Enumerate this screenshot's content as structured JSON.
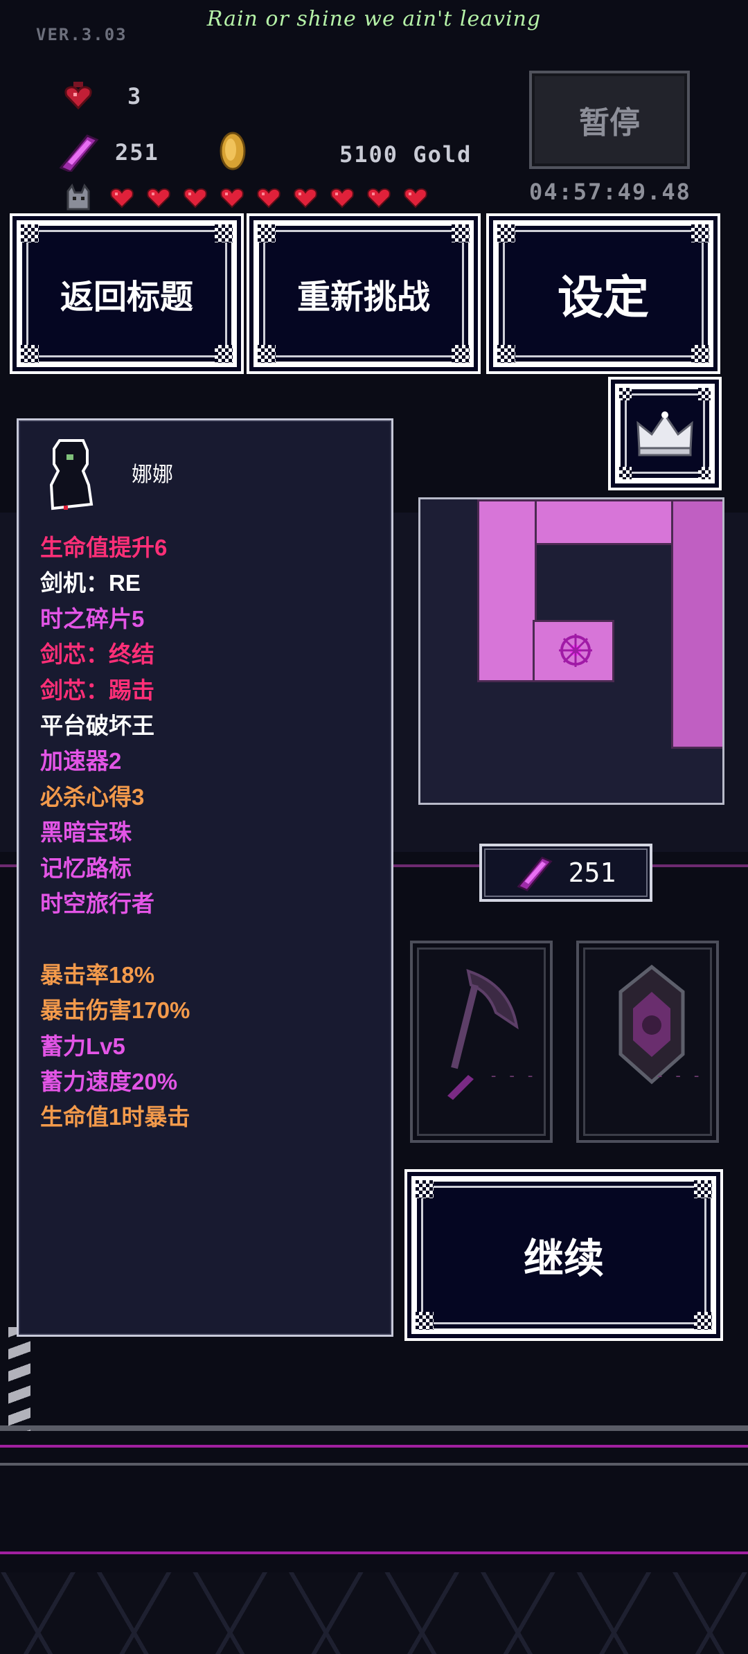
{
  "header": {
    "version": "VER.3.03",
    "now_playing": "Rain or shine we ain't leaving"
  },
  "stats": {
    "potions": "3",
    "crystals": "251",
    "gold": "5100 Gold",
    "health_hearts": 9
  },
  "top_right": {
    "pause_label": "暂停",
    "timer": "04:57:49.48"
  },
  "menu": {
    "return_title": "返回标题",
    "retry": "重新挑战",
    "settings": "设定"
  },
  "character": {
    "name": "娜娜"
  },
  "items": [
    {
      "text": "生命值提升6",
      "color": "#ff2f77"
    },
    {
      "text": "剑机：RE",
      "color": "#ffffff"
    },
    {
      "text": "时之碎片5",
      "color": "#e355e6"
    },
    {
      "text": "剑芯：终结",
      "color": "#ff2f77"
    },
    {
      "text": "剑芯：踢击",
      "color": "#ff2f77"
    },
    {
      "text": "平台破坏王",
      "color": "#ffffff"
    },
    {
      "text": "加速器2",
      "color": "#e355e6"
    },
    {
      "text": "必杀心得3",
      "color": "#f39a4b"
    },
    {
      "text": "黑暗宝珠",
      "color": "#e355e6"
    },
    {
      "text": "记忆路标",
      "color": "#e355e6"
    },
    {
      "text": "时空旅行者",
      "color": "#e355e6"
    }
  ],
  "bonuses": [
    {
      "text": "暴击率18%",
      "color": "#f39a4b"
    },
    {
      "text": "暴击伤害170%",
      "color": "#f39a4b"
    },
    {
      "text": "蓄力Lv5",
      "color": "#e355e6"
    },
    {
      "text": "蓄力速度20%",
      "color": "#e355e6"
    },
    {
      "text": "生命值1时暴击",
      "color": "#f39a4b"
    }
  ],
  "crystal_box": {
    "count": "251"
  },
  "continue_label": "继续",
  "colors": {
    "accent_magenta": "#d775d8",
    "background": "#0b0c16",
    "heart_red": "#e0213a"
  },
  "icons": [
    "heart-potion-icon",
    "crystal-icon",
    "gold-coin-icon",
    "cat-icon",
    "heart-icon",
    "crown-icon",
    "scythe-icon",
    "shield-icon"
  ]
}
